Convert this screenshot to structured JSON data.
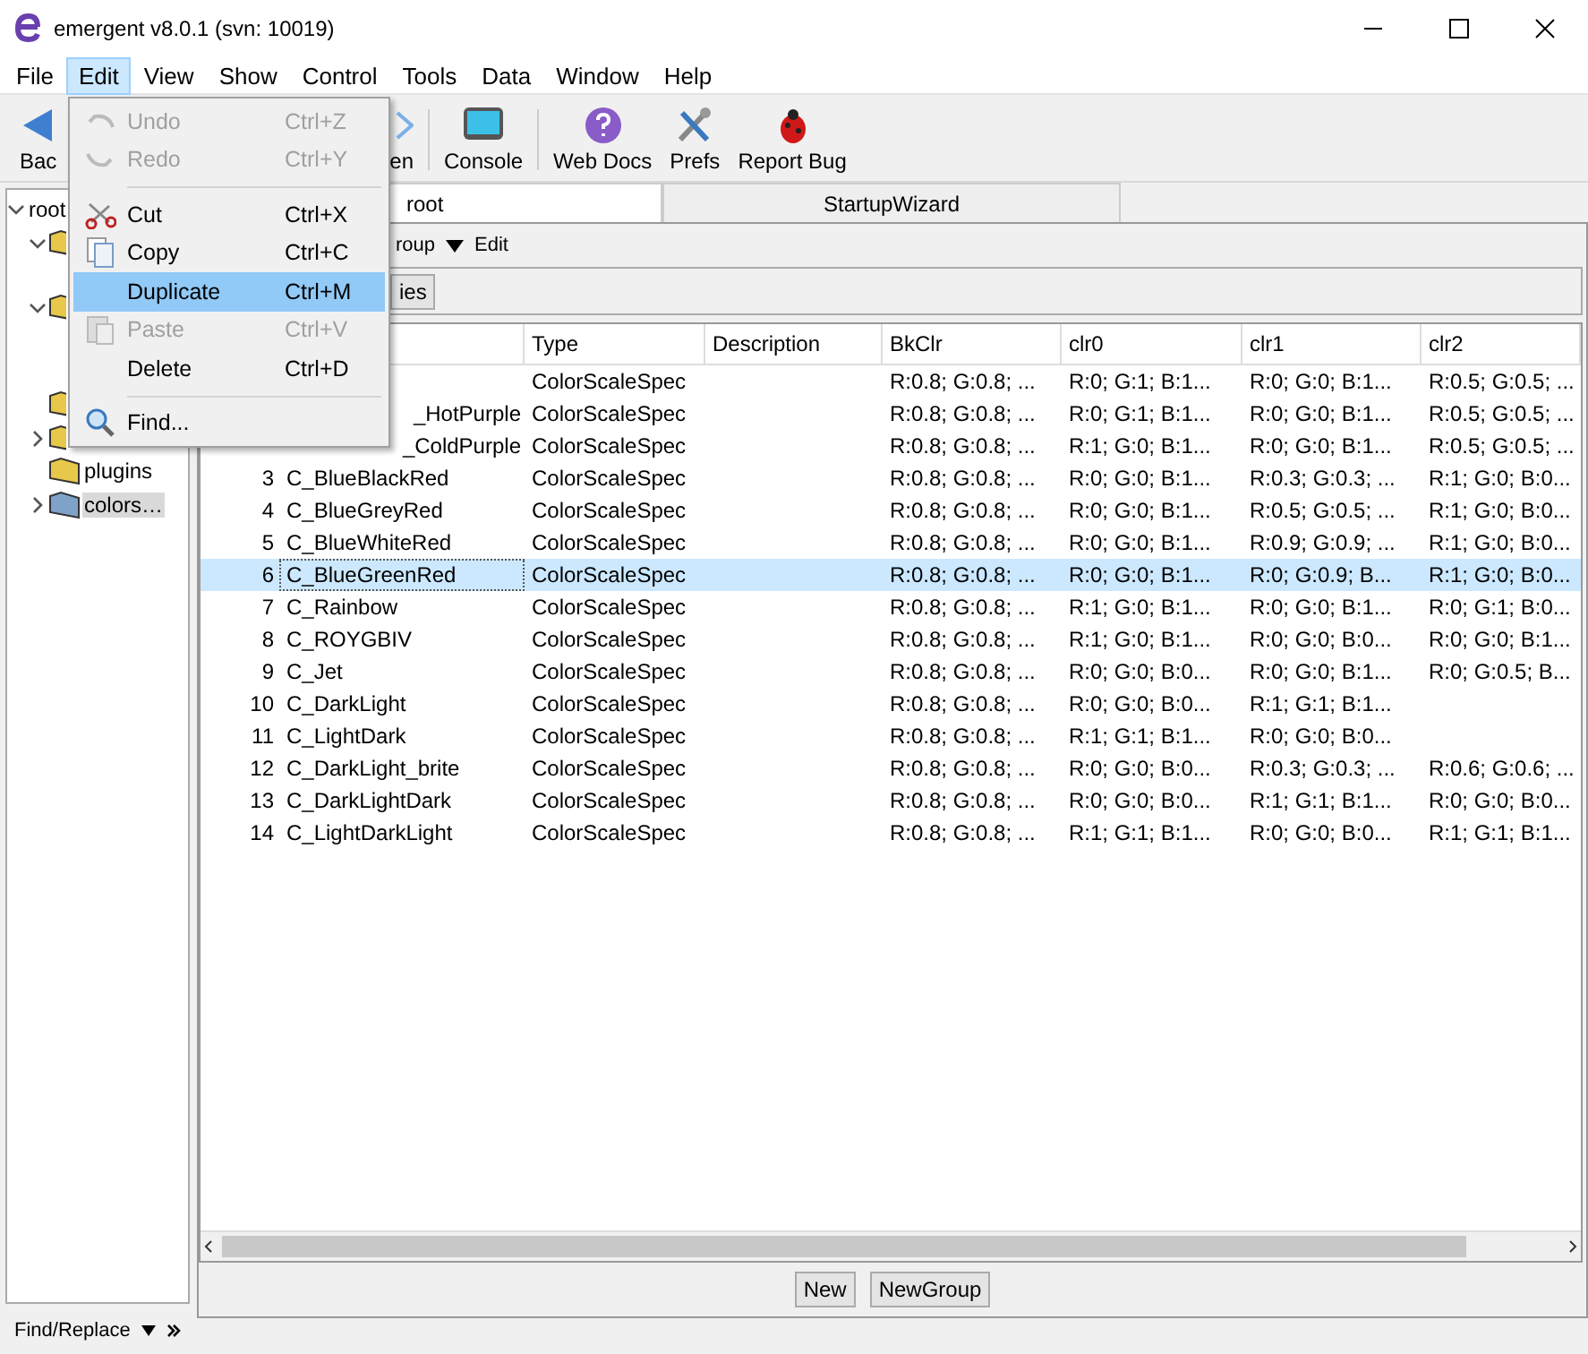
{
  "window": {
    "title": "emergent v8.0.1 (svn: 10019)"
  },
  "menubar": [
    {
      "label": "File",
      "selected": false
    },
    {
      "label": "Edit",
      "selected": true
    },
    {
      "label": "View",
      "selected": false
    },
    {
      "label": "Show",
      "selected": false
    },
    {
      "label": "Control",
      "selected": false
    },
    {
      "label": "Tools",
      "selected": false
    },
    {
      "label": "Data",
      "selected": false
    },
    {
      "label": "Window",
      "selected": false
    },
    {
      "label": "Help",
      "selected": false
    }
  ],
  "toolbar": [
    {
      "label": "Bac",
      "kind": "back"
    },
    {
      "label": "en",
      "kind": "open"
    },
    {
      "label": "Console",
      "kind": "console"
    },
    {
      "label": "Web Docs",
      "kind": "help"
    },
    {
      "label": "Prefs",
      "kind": "tools"
    },
    {
      "label": "Report Bug",
      "kind": "bug"
    }
  ],
  "edit_menu": [
    {
      "kind": "undo",
      "label": "Undo",
      "shortcut": "Ctrl+Z",
      "disabled": true,
      "selected": false
    },
    {
      "kind": "redo",
      "label": "Redo",
      "shortcut": "Ctrl+Y",
      "disabled": true,
      "selected": false
    },
    {
      "kind": "separator"
    },
    {
      "kind": "cut",
      "label": "Cut",
      "shortcut": "Ctrl+X",
      "disabled": false,
      "selected": false
    },
    {
      "kind": "copy",
      "label": "Copy",
      "shortcut": "Ctrl+C",
      "disabled": false,
      "selected": false
    },
    {
      "kind": "plain",
      "label": "Duplicate",
      "shortcut": "Ctrl+M",
      "disabled": false,
      "selected": true
    },
    {
      "kind": "paste",
      "label": "Paste",
      "shortcut": "Ctrl+V",
      "disabled": true,
      "selected": false
    },
    {
      "kind": "plain",
      "label": "Delete",
      "shortcut": "Ctrl+D",
      "disabled": false,
      "selected": false
    },
    {
      "kind": "separator"
    },
    {
      "kind": "find",
      "label": "Find...",
      "disabled": false,
      "selected": false
    }
  ],
  "tree": {
    "label": "root",
    "expanded": true,
    "selected": false,
    "children": [
      {
        "expanded": true,
        "selected": false
      },
      {
        "expanded": true,
        "selected": false
      },
      {
        "selected": false
      },
      {
        "expanded": false,
        "selected": false
      },
      {
        "label": "plugins",
        "selected": false
      },
      {
        "label": "colors…",
        "expanded": false,
        "selected": true
      }
    ]
  },
  "find_replace": {
    "label": "Find/Replace"
  },
  "tabs": [
    {
      "label": "root",
      "selected": true
    },
    {
      "label": "StartupWizard",
      "selected": false
    }
  ],
  "panel_toolbar": [
    {
      "label": "roup"
    },
    {
      "label": "Edit"
    }
  ],
  "panel_button": {
    "label": "ies"
  },
  "table": {
    "columns": [
      "Type",
      "Description",
      "BkClr",
      "clr0",
      "clr1",
      "clr2"
    ],
    "rows": [
      {
        "type": "ColorScaleSpec",
        "bkclr": "R:0.8; G:0.8; ...",
        "clr0": "R:0; G:1; B:1...",
        "clr1": "R:0; G:0; B:1...",
        "clr2": "R:0.5; G:0.5; ...",
        "selected": false
      },
      {
        "name": "_HotPurple",
        "type": "ColorScaleSpec",
        "bkclr": "R:0.8; G:0.8; ...",
        "clr0": "R:0; G:1; B:1...",
        "clr1": "R:0; G:0; B:1...",
        "clr2": "R:0.5; G:0.5; ...",
        "selected": false
      },
      {
        "name": "_ColdPurple",
        "type": "ColorScaleSpec",
        "bkclr": "R:0.8; G:0.8; ...",
        "clr0": "R:1; G:0; B:1...",
        "clr1": "R:0; G:0; B:1...",
        "clr2": "R:0.5; G:0.5; ...",
        "selected": false
      },
      {
        "num": "3",
        "name": "C_BlueBlackRed",
        "type": "ColorScaleSpec",
        "bkclr": "R:0.8; G:0.8; ...",
        "clr0": "R:0; G:0; B:1...",
        "clr1": "R:0.3; G:0.3; ...",
        "clr2": "R:1; G:0; B:0...",
        "selected": false
      },
      {
        "num": "4",
        "name": "C_BlueGreyRed",
        "type": "ColorScaleSpec",
        "bkclr": "R:0.8; G:0.8; ...",
        "clr0": "R:0; G:0; B:1...",
        "clr1": "R:0.5; G:0.5; ...",
        "clr2": "R:1; G:0; B:0...",
        "selected": false
      },
      {
        "num": "5",
        "name": "C_BlueWhiteRed",
        "type": "ColorScaleSpec",
        "bkclr": "R:0.8; G:0.8; ...",
        "clr0": "R:0; G:0; B:1...",
        "clr1": "R:0.9; G:0.9; ...",
        "clr2": "R:1; G:0; B:0...",
        "selected": false
      },
      {
        "num": "6",
        "name": "C_BlueGreenRed",
        "type": "ColorScaleSpec",
        "bkclr": "R:0.8; G:0.8; ...",
        "clr0": "R:0; G:0; B:1...",
        "clr1": "R:0; G:0.9; B...",
        "clr2": "R:1; G:0; B:0...",
        "selected": true
      },
      {
        "num": "7",
        "name": "C_Rainbow",
        "type": "ColorScaleSpec",
        "bkclr": "R:0.8; G:0.8; ...",
        "clr0": "R:1; G:0; B:1...",
        "clr1": "R:0; G:0; B:1...",
        "clr2": "R:0; G:1; B:0...",
        "selected": false
      },
      {
        "num": "8",
        "name": "C_ROYGBIV",
        "type": "ColorScaleSpec",
        "bkclr": "R:0.8; G:0.8; ...",
        "clr0": "R:1; G:0; B:1...",
        "clr1": "R:0; G:0; B:0...",
        "clr2": "R:0; G:0; B:1...",
        "selected": false
      },
      {
        "num": "9",
        "name": "C_Jet",
        "type": "ColorScaleSpec",
        "bkclr": "R:0.8; G:0.8; ...",
        "clr0": "R:0; G:0; B:0...",
        "clr1": "R:0; G:0; B:1...",
        "clr2": "R:0; G:0.5; B...",
        "selected": false
      },
      {
        "num": "10",
        "name": "C_DarkLight",
        "type": "ColorScaleSpec",
        "bkclr": "R:0.8; G:0.8; ...",
        "clr0": "R:0; G:0; B:0...",
        "clr1": "R:1; G:1; B:1...",
        "selected": false
      },
      {
        "num": "11",
        "name": "C_LightDark",
        "type": "ColorScaleSpec",
        "bkclr": "R:0.8; G:0.8; ...",
        "clr0": "R:1; G:1; B:1...",
        "clr1": "R:0; G:0; B:0...",
        "selected": false
      },
      {
        "num": "12",
        "name": "C_DarkLight_brite",
        "type": "ColorScaleSpec",
        "bkclr": "R:0.8; G:0.8; ...",
        "clr0": "R:0; G:0; B:0...",
        "clr1": "R:0.3; G:0.3; ...",
        "clr2": "R:0.6; G:0.6; ...",
        "selected": false
      },
      {
        "num": "13",
        "name": "C_DarkLightDark",
        "type": "ColorScaleSpec",
        "bkclr": "R:0.8; G:0.8; ...",
        "clr0": "R:0; G:0; B:0...",
        "clr1": "R:1; G:1; B:1...",
        "clr2": "R:0; G:0; B:0...",
        "selected": false
      },
      {
        "num": "14",
        "name": "C_LightDarkLight",
        "type": "ColorScaleSpec",
        "bkclr": "R:0.8; G:0.8; ...",
        "clr0": "R:1; G:1; B:1...",
        "clr1": "R:0; G:0; B:0...",
        "clr2": "R:1; G:1; B:1...",
        "selected": false
      }
    ]
  },
  "bottom_buttons": [
    "New",
    "NewGroup"
  ]
}
